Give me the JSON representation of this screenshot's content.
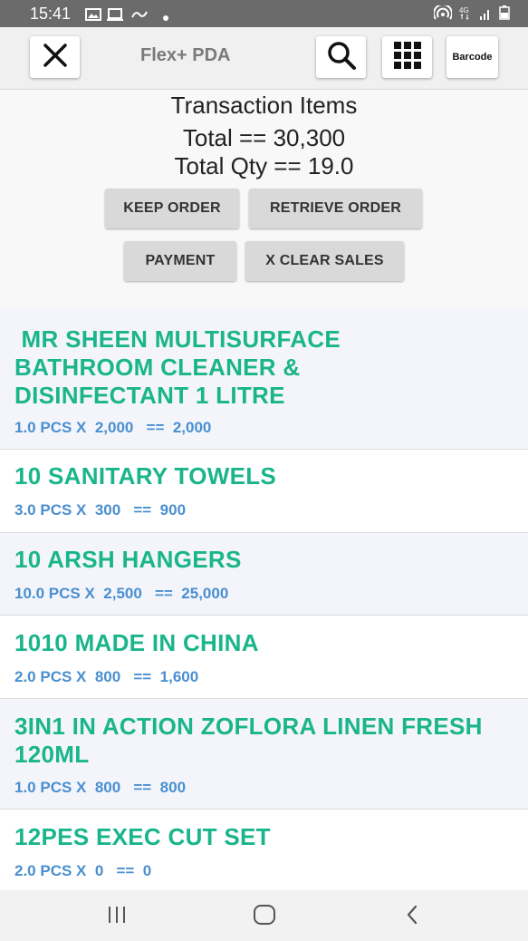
{
  "status_bar": {
    "time": "15:41",
    "left_icons": [
      "image-icon",
      "cast-icon",
      "link-icon",
      "dot-icon"
    ],
    "right_icons": [
      "hotspot-icon",
      "4g-icon",
      "signal-icon",
      "battery-icon"
    ]
  },
  "app_bar": {
    "title": "Flex+ PDA",
    "barcode_label": "Barcode",
    "icons": [
      "close-icon",
      "search-icon",
      "grid-icon"
    ]
  },
  "summary": {
    "title": "Transaction Items",
    "total": "Total == 30,300",
    "total_qty": "Total Qty == 19.0"
  },
  "actions": {
    "keep_order": "KEEP ORDER",
    "retrieve_order": "RETRIEVE ORDER",
    "payment": "PAYMENT",
    "clear_sales": "X CLEAR SALES"
  },
  "items": [
    {
      "name": " MR SHEEN MULTISURFACE BATHROOM CLEANER & DISINFECTANT 1 LITRE",
      "detail": "1.0 PCS X  2,000   ==  2,000"
    },
    {
      "name": "10 SANITARY TOWELS",
      "detail": "3.0 PCS X  300   ==  900"
    },
    {
      "name": "10 ARSH HANGERS",
      "detail": "10.0 PCS X  2,500   ==  25,000"
    },
    {
      "name": "1010  MADE IN CHINA",
      "detail": "2.0 PCS X  800   ==  1,600"
    },
    {
      "name": "3IN1 IN ACTION ZOFLORA LINEN FRESH 120ML",
      "detail": "1.0 PCS X  800   ==  800"
    },
    {
      "name": "12PES EXEC CUT SET",
      "detail": "2.0 PCS X  0   ==  0"
    }
  ],
  "colors": {
    "item_name": "#1ab58a",
    "item_detail": "#4a8fd0",
    "item_alt_bg": "#f3f5fb",
    "button_bg": "#d9d9d9"
  },
  "nav_bar": {
    "icons": [
      "recents-icon",
      "home-icon",
      "back-icon"
    ]
  }
}
